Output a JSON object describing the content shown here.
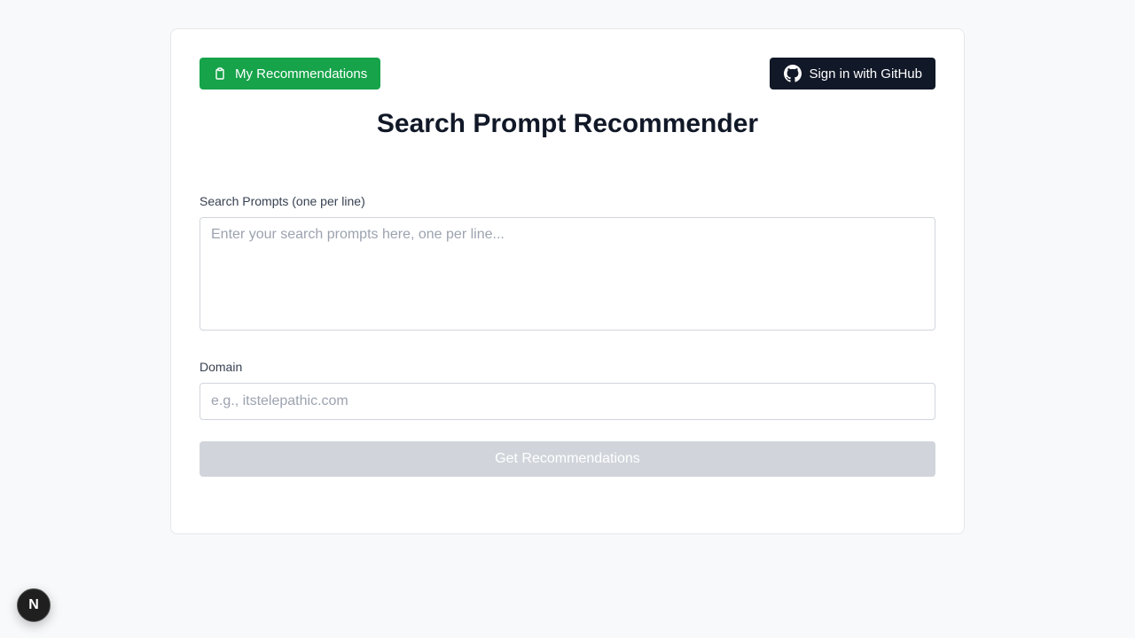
{
  "header": {
    "recommendations_button": {
      "label": "My Recommendations",
      "icon": "clipboard-icon",
      "color": "#16a34a"
    },
    "github_button": {
      "label": "Sign in with GitHub",
      "icon": "github-icon",
      "color": "#111827"
    }
  },
  "page_title": "Search Prompt Recommender",
  "form": {
    "prompts_label": "Search Prompts (one per line)",
    "prompts_placeholder": "Enter your search prompts here, one per line...",
    "prompts_value": "",
    "domain_label": "Domain",
    "domain_placeholder": "e.g., itstelepathic.com",
    "domain_value": "",
    "submit_label": "Get Recommendations",
    "submit_disabled_color": "#d1d5db"
  },
  "dev_badge": {
    "label": "N",
    "icon": "nextjs-icon"
  }
}
